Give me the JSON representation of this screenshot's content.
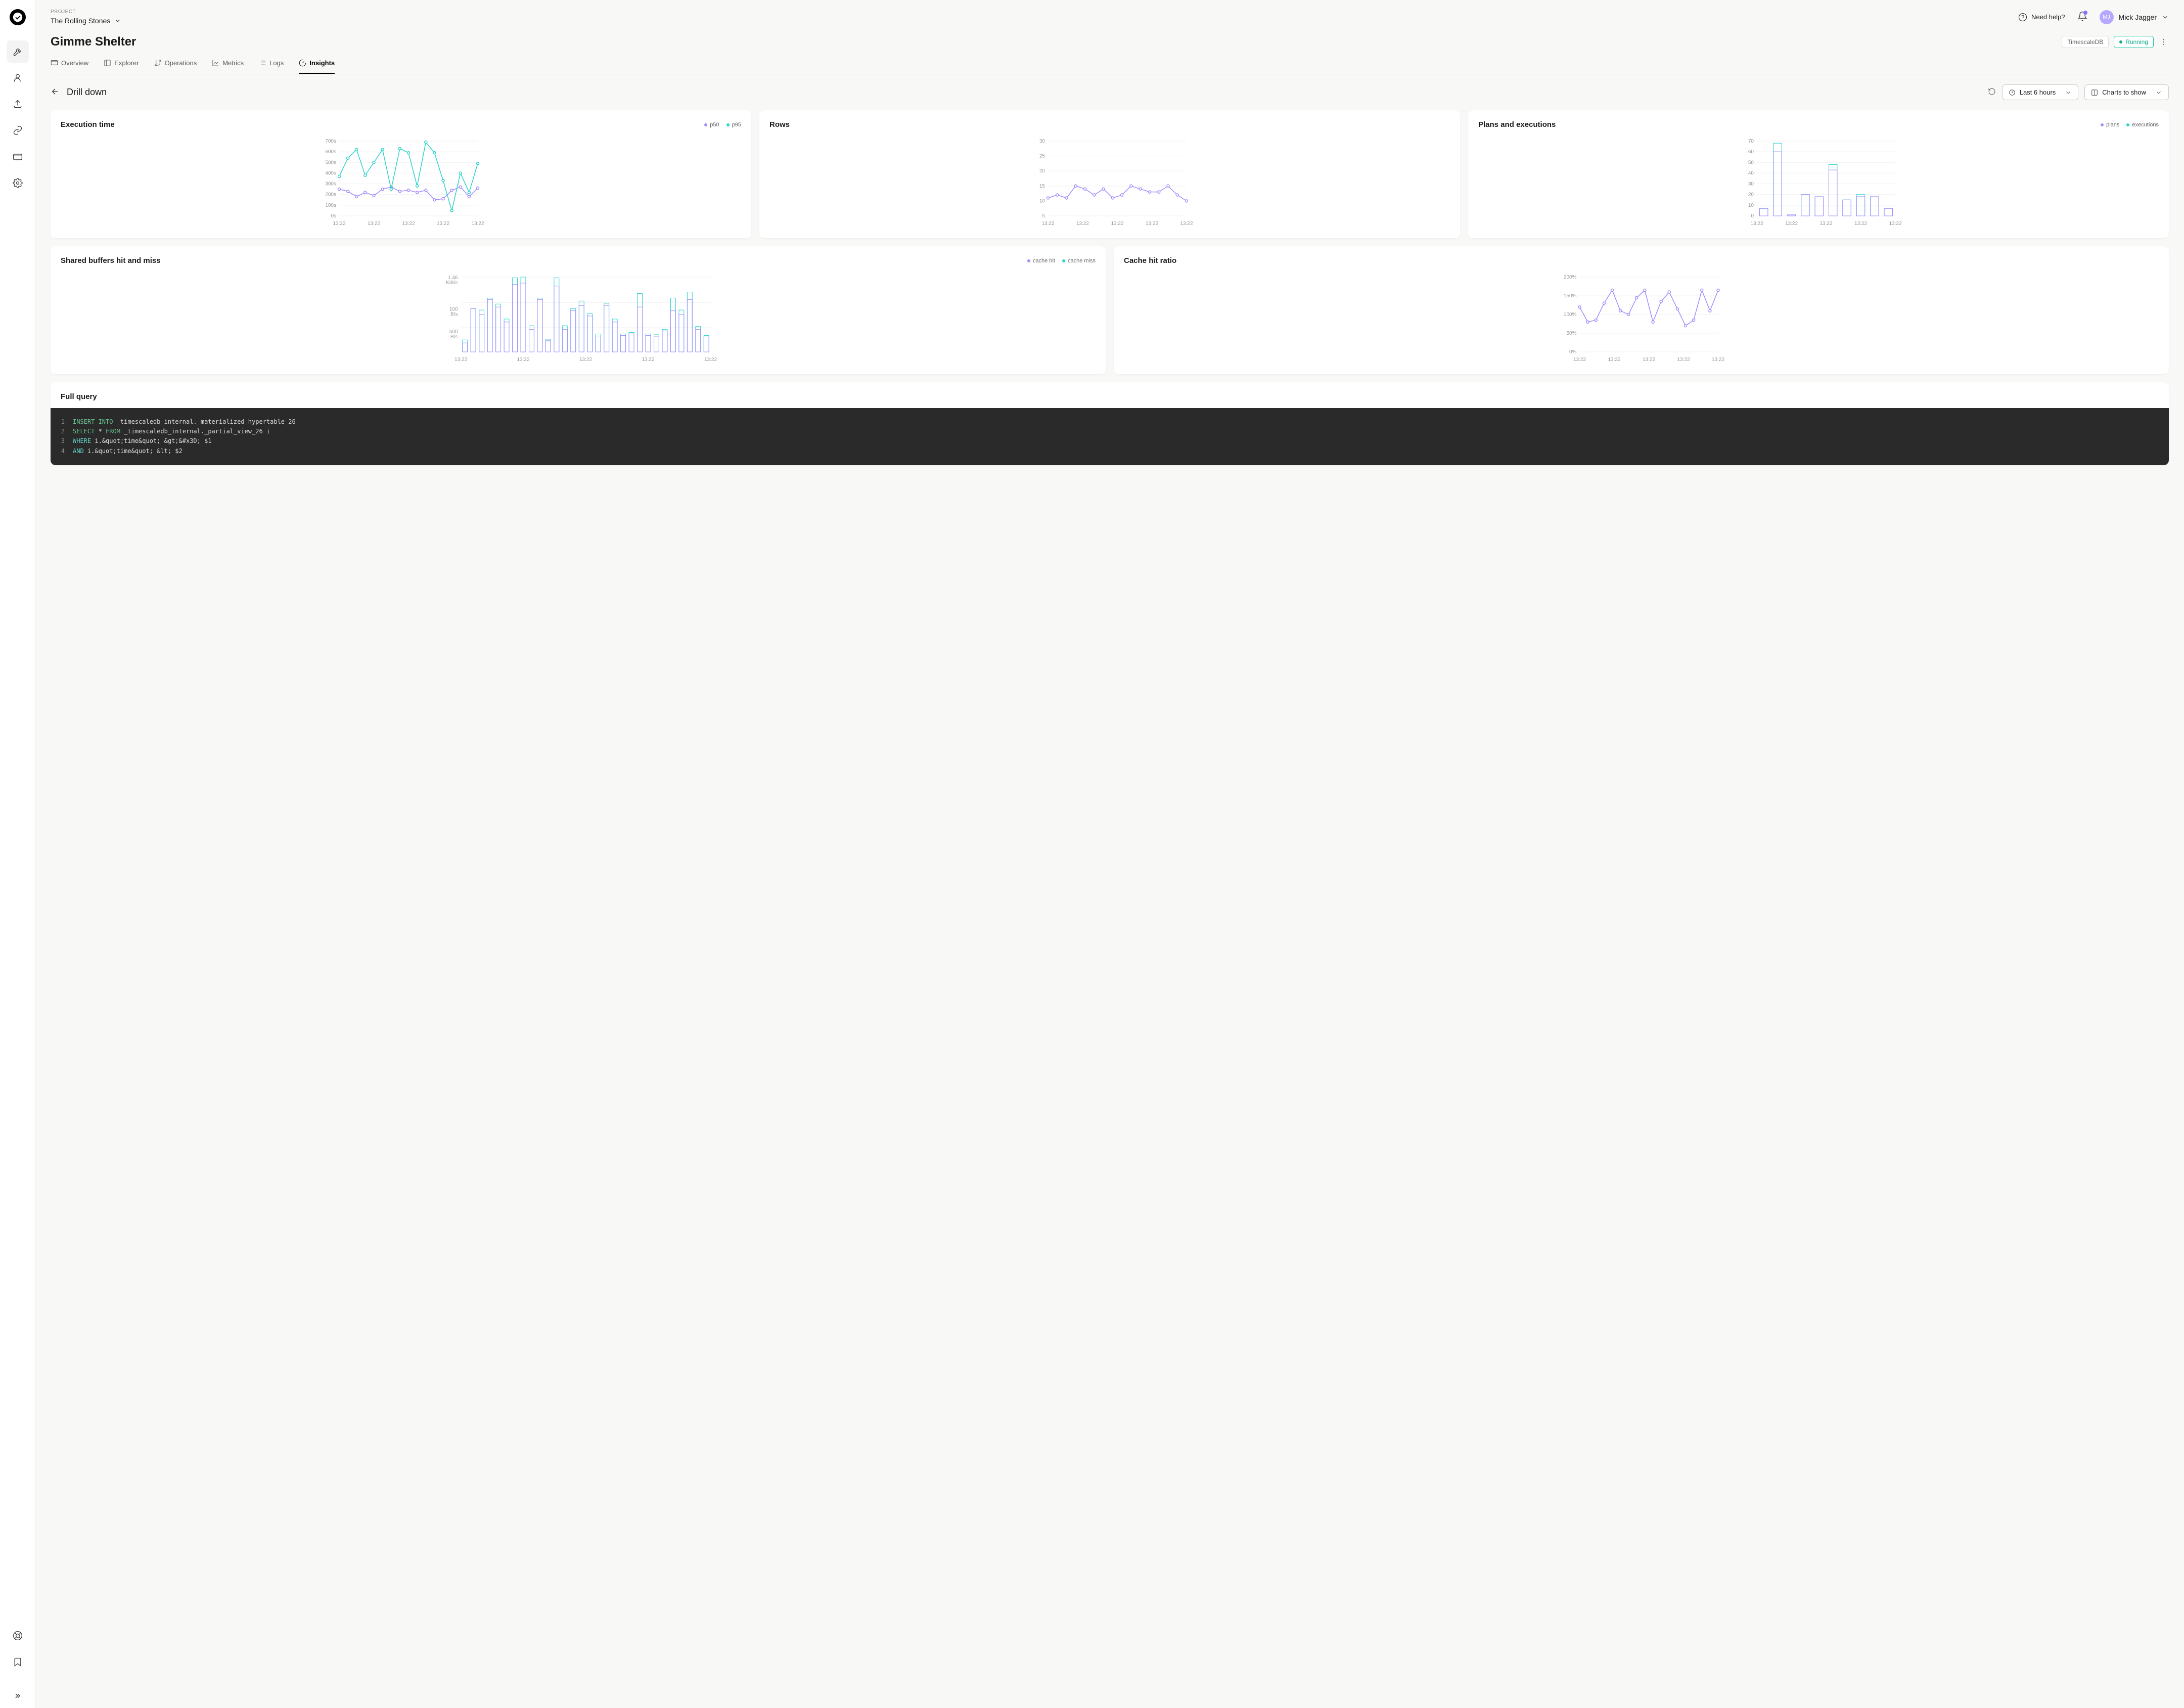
{
  "header": {
    "project_label": "PROJECT",
    "project_name": "The Rolling Stones",
    "help_text": "Need help?",
    "user_initials": "MJ",
    "user_name": "Mick Jagger"
  },
  "page": {
    "title": "Gimme Shelter",
    "db_badge": "TimescaleDB",
    "status_label": "Running",
    "drill_down": "Drill down",
    "time_range": "Last 6 hours",
    "charts_show": "Charts to show"
  },
  "tabs": [
    {
      "id": "overview",
      "label": "Overview"
    },
    {
      "id": "explorer",
      "label": "Explorer"
    },
    {
      "id": "operations",
      "label": "Operations"
    },
    {
      "id": "metrics",
      "label": "Metrics"
    },
    {
      "id": "logs",
      "label": "Logs"
    },
    {
      "id": "insights",
      "label": "Insights"
    }
  ],
  "charts": {
    "execution": {
      "title": "Execution time",
      "legend": [
        {
          "label": "p50",
          "color": "#a28bff"
        },
        {
          "label": "p95",
          "color": "#2cd3cb"
        }
      ]
    },
    "rows": {
      "title": "Rows"
    },
    "plans": {
      "title": "Plans and executions",
      "legend": [
        {
          "label": "plans",
          "color": "#a28bff"
        },
        {
          "label": "executions",
          "color": "#2cd3cb"
        }
      ]
    },
    "buffers": {
      "title": "Shared buffers hit and miss",
      "legend": [
        {
          "label": "cache hit",
          "color": "#a28bff"
        },
        {
          "label": "cache miss",
          "color": "#2cd3cb"
        }
      ]
    },
    "cache": {
      "title": "Cache hit ratio"
    }
  },
  "query": {
    "title": "Full query",
    "lines": [
      {
        "num": "1",
        "parts": [
          {
            "t": "INSERT INTO ",
            "c": "kw1"
          },
          {
            "t": "_timescaledb_internal._materialized_hypertable_26",
            "c": ""
          }
        ]
      },
      {
        "num": "2",
        "parts": [
          {
            "t": "SELECT ",
            "c": "kw1"
          },
          {
            "t": "* ",
            "c": ""
          },
          {
            "t": "FROM ",
            "c": "kw1"
          },
          {
            "t": "_timescaledb_internal._partial_view_26 i",
            "c": ""
          }
        ]
      },
      {
        "num": "3",
        "parts": [
          {
            "t": "WHERE ",
            "c": "kw2"
          },
          {
            "t": "i.&quot;time&quot; &gt;&#x3D; $1",
            "c": ""
          }
        ]
      },
      {
        "num": "4",
        "parts": [
          {
            "t": "AND ",
            "c": "kw2"
          },
          {
            "t": "i.&quot;time&quot; &lt; $2",
            "c": ""
          }
        ]
      }
    ]
  },
  "chart_data": [
    {
      "id": "execution_time",
      "type": "line",
      "title": "Execution time",
      "ylabel": "seconds",
      "ylim": [
        0,
        700
      ],
      "y_ticks": [
        0,
        100,
        200,
        300,
        400,
        500,
        600,
        700
      ],
      "y_tick_suffix": "s",
      "x_ticks": [
        "13:22",
        "13:22",
        "13:22",
        "13:22",
        "13:22"
      ],
      "series": [
        {
          "name": "p50",
          "color": "#a28bff",
          "values": [
            250,
            230,
            180,
            220,
            190,
            250,
            270,
            230,
            240,
            220,
            240,
            150,
            160,
            240,
            270,
            180,
            260
          ]
        },
        {
          "name": "p95",
          "color": "#2cd3cb",
          "values": [
            370,
            540,
            620,
            380,
            500,
            620,
            250,
            630,
            590,
            280,
            690,
            590,
            330,
            50,
            400,
            220,
            490
          ]
        }
      ]
    },
    {
      "id": "rows",
      "type": "line",
      "title": "Rows",
      "ylim": [
        5,
        30
      ],
      "y_ticks": [
        5,
        10,
        15,
        20,
        25,
        30
      ],
      "x_ticks": [
        "13:22",
        "13:22",
        "13:22",
        "13:22",
        "13:22"
      ],
      "series": [
        {
          "name": "rows",
          "color": "#a28bff",
          "values": [
            11,
            12,
            11,
            15,
            14,
            12,
            14,
            11,
            12,
            15,
            14,
            13,
            13,
            15,
            12,
            10
          ]
        }
      ]
    },
    {
      "id": "plans_executions",
      "type": "bar",
      "title": "Plans and executions",
      "ylim": [
        0,
        70
      ],
      "y_ticks": [
        0,
        10,
        20,
        30,
        40,
        50,
        60,
        70
      ],
      "x_ticks": [
        "13:22",
        "13:22",
        "13:22",
        "13:22",
        "13:22"
      ],
      "series": [
        {
          "name": "plans",
          "color": "#a28bff",
          "values": [
            7,
            60,
            1,
            20,
            18,
            43,
            15,
            18,
            18,
            7
          ]
        },
        {
          "name": "executions",
          "color": "#2cd3cb",
          "values": [
            7,
            68,
            1,
            20,
            18,
            48,
            15,
            20,
            18,
            7
          ]
        }
      ]
    },
    {
      "id": "shared_buffers",
      "type": "bar",
      "title": "Shared buffers hit and miss",
      "y_ticks_labels": [
        "1.46 KiB/s",
        "100 B/s",
        "500 B/s"
      ],
      "x_ticks": [
        "13:22",
        "13:22",
        "13:22",
        "13:22",
        "13:22"
      ],
      "series": [
        {
          "name": "cache hit",
          "color": "#a28bff",
          "values": [
            0.12,
            0.58,
            0.5,
            0.7,
            0.6,
            0.4,
            0.9,
            0.92,
            0.3,
            0.7,
            0.15,
            0.88,
            0.3,
            0.55,
            0.62,
            0.48,
            0.2,
            0.62,
            0.4,
            0.22,
            0.24,
            0.6,
            0.22,
            0.21,
            0.28,
            0.55,
            0.5,
            0.7,
            0.3,
            0.2
          ]
        },
        {
          "name": "cache miss",
          "color": "#2cd3cb",
          "values": [
            0.16,
            0.58,
            0.56,
            0.72,
            0.64,
            0.44,
            0.99,
            1.0,
            0.35,
            0.72,
            0.17,
            0.99,
            0.35,
            0.58,
            0.68,
            0.51,
            0.24,
            0.65,
            0.44,
            0.24,
            0.26,
            0.78,
            0.24,
            0.23,
            0.3,
            0.72,
            0.56,
            0.8,
            0.34,
            0.22
          ]
        }
      ]
    },
    {
      "id": "cache_hit_ratio",
      "type": "line",
      "title": "Cache hit ratio",
      "ylabel": "%",
      "ylim": [
        0,
        200
      ],
      "y_ticks": [
        0,
        50,
        100,
        150,
        200
      ],
      "y_tick_suffix": "%",
      "x_ticks": [
        "13:22",
        "13:22",
        "13:22",
        "13:22",
        "13:22"
      ],
      "series": [
        {
          "name": "ratio",
          "color": "#a28bff",
          "values": [
            120,
            80,
            85,
            130,
            165,
            110,
            100,
            145,
            165,
            80,
            135,
            160,
            115,
            70,
            85,
            165,
            110,
            165
          ]
        }
      ]
    }
  ]
}
